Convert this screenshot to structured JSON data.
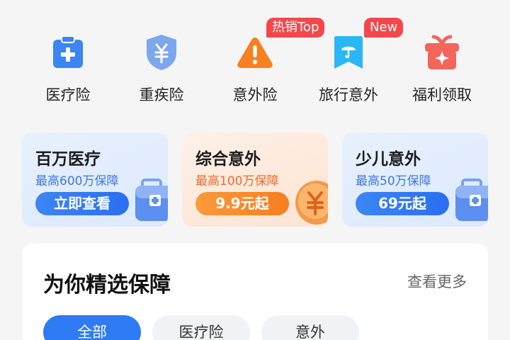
{
  "icons": [
    {
      "label": "医疗险",
      "icon": "medical-clipboard-icon",
      "color": "#3a86f5"
    },
    {
      "label": "重疾险",
      "icon": "shield-yuan-icon",
      "color": "#7da7ec"
    },
    {
      "label": "意外险",
      "icon": "warning-icon",
      "color": "#f8801f",
      "badge": "热销Top"
    },
    {
      "label": "旅行意外",
      "icon": "umbrella-bookmark-icon",
      "color": "#2ab7f6",
      "badge": "New"
    },
    {
      "label": "福利领取",
      "icon": "gift-icon",
      "color": "#f4655b"
    }
  ],
  "cards": [
    {
      "title": "百万医疗",
      "subtitle": "最高600万保障",
      "button": "立即查看",
      "theme": "blue",
      "art": "medical-kit-icon"
    },
    {
      "title": "综合意外",
      "subtitle": "最高100万保障",
      "button": "9.9元起",
      "theme": "orange",
      "art": "yuan-coin-icon"
    },
    {
      "title": "少儿意外",
      "subtitle": "最高50万保障",
      "button": "69元起",
      "theme": "blue",
      "art": "medical-kit-icon"
    }
  ],
  "section": {
    "title": "为你精选保障",
    "more": "查看更多",
    "tabs": [
      "全部",
      "医疗险",
      "意外"
    ],
    "active_tab": "全部"
  },
  "colors": {
    "primary": "#2f7af5",
    "orange": "#f67e20",
    "badge": "#f5474a"
  }
}
